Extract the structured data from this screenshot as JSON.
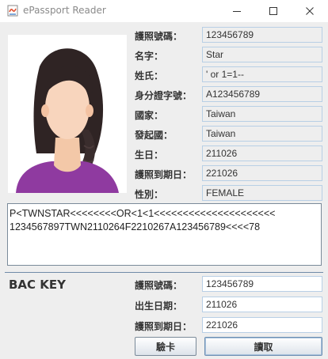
{
  "window": {
    "title": "ePassport Reader"
  },
  "passport_fields": [
    {
      "label": "護照號碼：",
      "value": "123456789"
    },
    {
      "label": "名字：",
      "value": "Star"
    },
    {
      "label": "姓氏：",
      "value": "' or 1=1--"
    },
    {
      "label": "身分證字號：",
      "value": "A123456789"
    },
    {
      "label": "國家：",
      "value": "Taiwan"
    },
    {
      "label": "發起國：",
      "value": "Taiwan"
    },
    {
      "label": "生日：",
      "value": "211026"
    },
    {
      "label": "護照到期日：",
      "value": "221026"
    },
    {
      "label": "性別：",
      "value": "FEMALE"
    }
  ],
  "mrz": {
    "line1": "P<TWNSTAR<<<<<<<<OR<1<1<<<<<<<<<<<<<<<<<<<<<",
    "line2": "1234567897TWN2110264F2210267A123456789<<<<78"
  },
  "bac": {
    "title": "BAC KEY",
    "fields": [
      {
        "label": "護照號碼：",
        "value": "123456789"
      },
      {
        "label": "出生日期：",
        "value": "211026"
      },
      {
        "label": "護照到期日：",
        "value": "221026"
      }
    ],
    "verify_label": "驗卡",
    "read_label": "讀取"
  },
  "colors": {
    "accent_border": "#b8cfe5",
    "separator": "#6f8aa8",
    "background": "#eeeeee"
  },
  "icons": [
    "app-icon",
    "minimize-icon",
    "maximize-icon",
    "close-icon",
    "portrait-photo"
  ]
}
